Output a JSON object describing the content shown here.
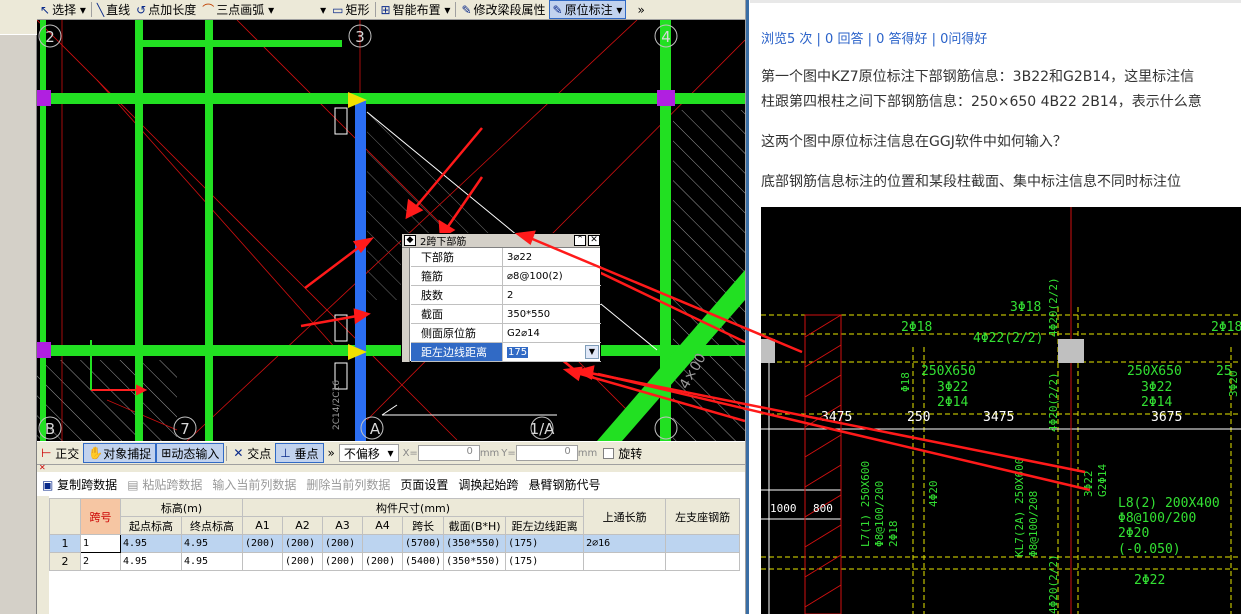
{
  "toolbar": {
    "items": [
      {
        "label": "选择",
        "icon": "cursor-icon"
      },
      {
        "label": "直线",
        "icon": "line-icon"
      },
      {
        "label": "点加长度",
        "icon": "point-length-icon"
      },
      {
        "label": "三点画弧",
        "icon": "arc-icon"
      },
      {
        "label": "矩形",
        "icon": "rectangle-icon"
      },
      {
        "label": "智能布置",
        "icon": "smart-layout-icon"
      },
      {
        "label": "修改梁段属性",
        "icon": "beam-property-icon"
      },
      {
        "label": "原位标注",
        "icon": "inplace-annotation-icon"
      }
    ]
  },
  "cad": {
    "axis_labels": [
      "2",
      "3",
      "4",
      "B",
      "7",
      "A",
      "1/A"
    ],
    "rebar_text": "2C14/2C16",
    "right_text": "4×00"
  },
  "popup": {
    "title": "2跨下部筋",
    "rows": [
      {
        "key": "下部筋",
        "value": "3⌀22"
      },
      {
        "key": "箍筋",
        "value": "⌀8@100(2)"
      },
      {
        "key": "肢数",
        "value": "2"
      },
      {
        "key": "截面",
        "value": "350*550"
      },
      {
        "key": "侧面原位筋",
        "value": "G2⌀14"
      },
      {
        "key": "距左边线距离",
        "value": "175"
      }
    ]
  },
  "statusbar": {
    "items": [
      "正交",
      "对象捕捉",
      "动态输入",
      "交点",
      "垂点"
    ],
    "offset_mode": "不偏移",
    "x_label": "X=",
    "x_value": "0",
    "y_label": "Y=",
    "y_value": "0",
    "unit": "mm",
    "rotate": "旋转"
  },
  "gridtool": {
    "items": [
      "复制跨数据",
      "粘贴跨数据",
      "输入当前列数据",
      "删除当前列数据",
      "页面设置",
      "调换起始跨",
      "悬臂钢筋代号"
    ]
  },
  "grid": {
    "headers_top": [
      "跨号",
      "标高(m)",
      "构件尺寸(mm)",
      "上通长筋",
      "左支座钢筋"
    ],
    "headers_sub": [
      "起点标高",
      "终点标高",
      "A1",
      "A2",
      "A3",
      "A4",
      "跨长",
      "截面(B*H)",
      "距左边线距离"
    ],
    "rows": [
      {
        "n": "1",
        "span": "1",
        "s": "4.95",
        "e": "4.95",
        "a1": "(200)",
        "a2": "(200)",
        "a3": "(200)",
        "a4": "",
        "len": "(5700)",
        "sec": "(350*550)",
        "dist": "(175)",
        "top": "2⌀16",
        "left": ""
      },
      {
        "n": "2",
        "span": "2",
        "s": "4.95",
        "e": "4.95",
        "a1": "",
        "a2": "(200)",
        "a3": "(200)",
        "a4": "(200)",
        "len": "(5400)",
        "sec": "(350*550)",
        "dist": "(175)",
        "top": "",
        "left": ""
      }
    ]
  },
  "right": {
    "meta": "浏览5 次 | 0 回答 | 0 答得好 | 0问得好",
    "p1a": "第一个图中KZ7原位标注下部钢筋信息：3B22和G2B14，这里标注信",
    "p1b": "柱跟第四根柱之间下部钢筋信息：250×650 4B22 2B14，表示什么意",
    "p2": "这两个图中原位标注信息在GGJ软件中如何输入？",
    "p3": "底部钢筋信息标注的位置和某段柱截面、集中标注信息不同时标注位",
    "drawing_texts": {
      "t1": "3Φ18",
      "t2": "2Φ18",
      "t3": "4Φ22(2/2)",
      "t4": "4Φ20(2/2)",
      "t5": "2Φ18",
      "t6": "250X650",
      "t7": "3Φ22",
      "t8": "2Φ14",
      "t9": "250X650",
      "t10": "3Φ22",
      "t11": "2Φ14",
      "t12": "3475",
      "t13": "250",
      "t14": "3475",
      "t15": "3675",
      "t16": "1000",
      "t17": "800",
      "t18": "L7(1) 250X600",
      "t19": "KL7(2A) 250X600",
      "t20": "L8(2) 200X400",
      "t21": "Φ8@100/200",
      "t22": "2Φ20",
      "t23": "(-0.050)",
      "t24": "2Φ22",
      "t25": "3Φ22",
      "t26": "G2Φ14",
      "t27": "Φ8@100/200",
      "t28": "Φ8@100/208",
      "t29": "2Φ18",
      "t30": "4Φ20",
      "t31": "4Φ20(2/2)",
      "t32": "4Φ20(2/2)",
      "t33": "Φ18",
      "t34": "3Φ20",
      "t35": "25"
    }
  },
  "colors": {
    "beam_green": "#22e022",
    "beam_blue": "#2b6ef2",
    "arrow_red": "#ff1a1a",
    "column_purple": "#b020e0",
    "cad_bg": "#000000",
    "drawing_yellow": "#e6e600",
    "drawing_green": "#33e033"
  }
}
